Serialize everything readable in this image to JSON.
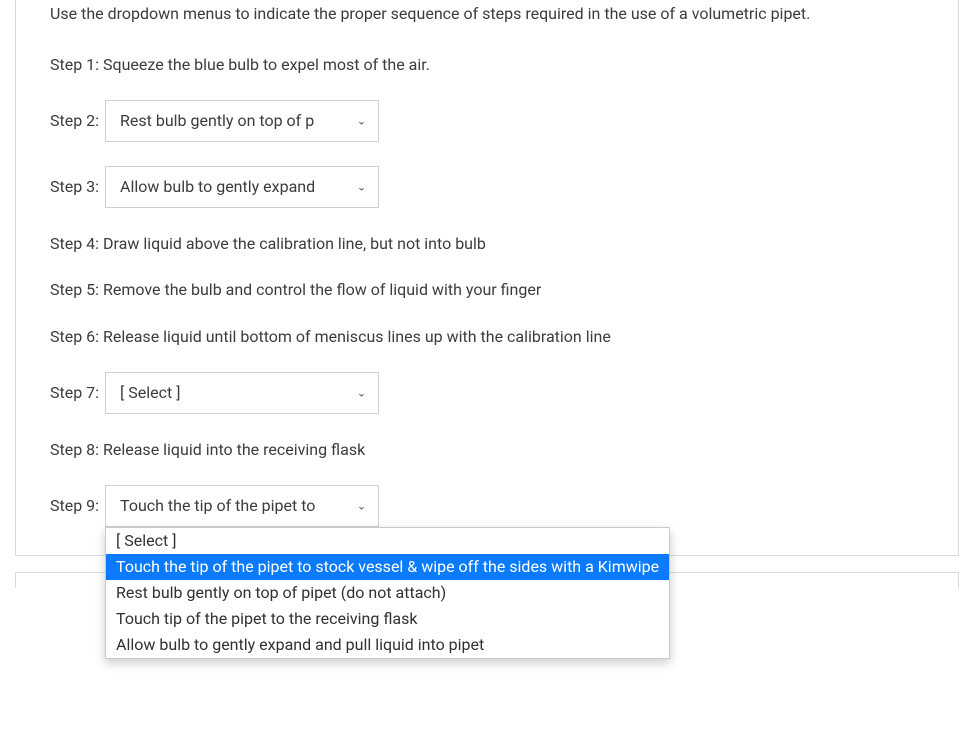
{
  "intro": "Use the dropdown menus to indicate the proper sequence of steps required in the use of a volumetric pipet.",
  "step1": {
    "label": "Step 1: Squeeze the blue bulb to expel most of the air."
  },
  "step2": {
    "label": "Step 2:",
    "selected": "Rest bulb gently on top of p"
  },
  "step3": {
    "label": "Step 3:",
    "selected": "Allow bulb to gently expand"
  },
  "step4": {
    "label": "Step 4: Draw liquid above the calibration line, but not into bulb"
  },
  "step5": {
    "label": "Step 5: Remove the bulb and control the flow of liquid with your finger"
  },
  "step6": {
    "label": "Step 6: Release liquid until bottom of meniscus lines up with the calibration line"
  },
  "step7": {
    "label": "Step 7:",
    "selected": "[ Select ]"
  },
  "step8": {
    "label": "Step 8: Release liquid into the receiving flask"
  },
  "step9": {
    "label": "Step 9:",
    "selected": "Touch the tip of the pipet to",
    "options": [
      "[ Select ]",
      "Touch the tip of the pipet to stock vessel & wipe off the sides with a Kimwipe",
      "Rest bulb gently on top of pipet (do not attach)",
      "Touch tip of the pipet to the receiving flask",
      "Allow bulb to gently expand and pull liquid into pipet"
    ],
    "highlight_index": 1
  },
  "caret": "⌄"
}
